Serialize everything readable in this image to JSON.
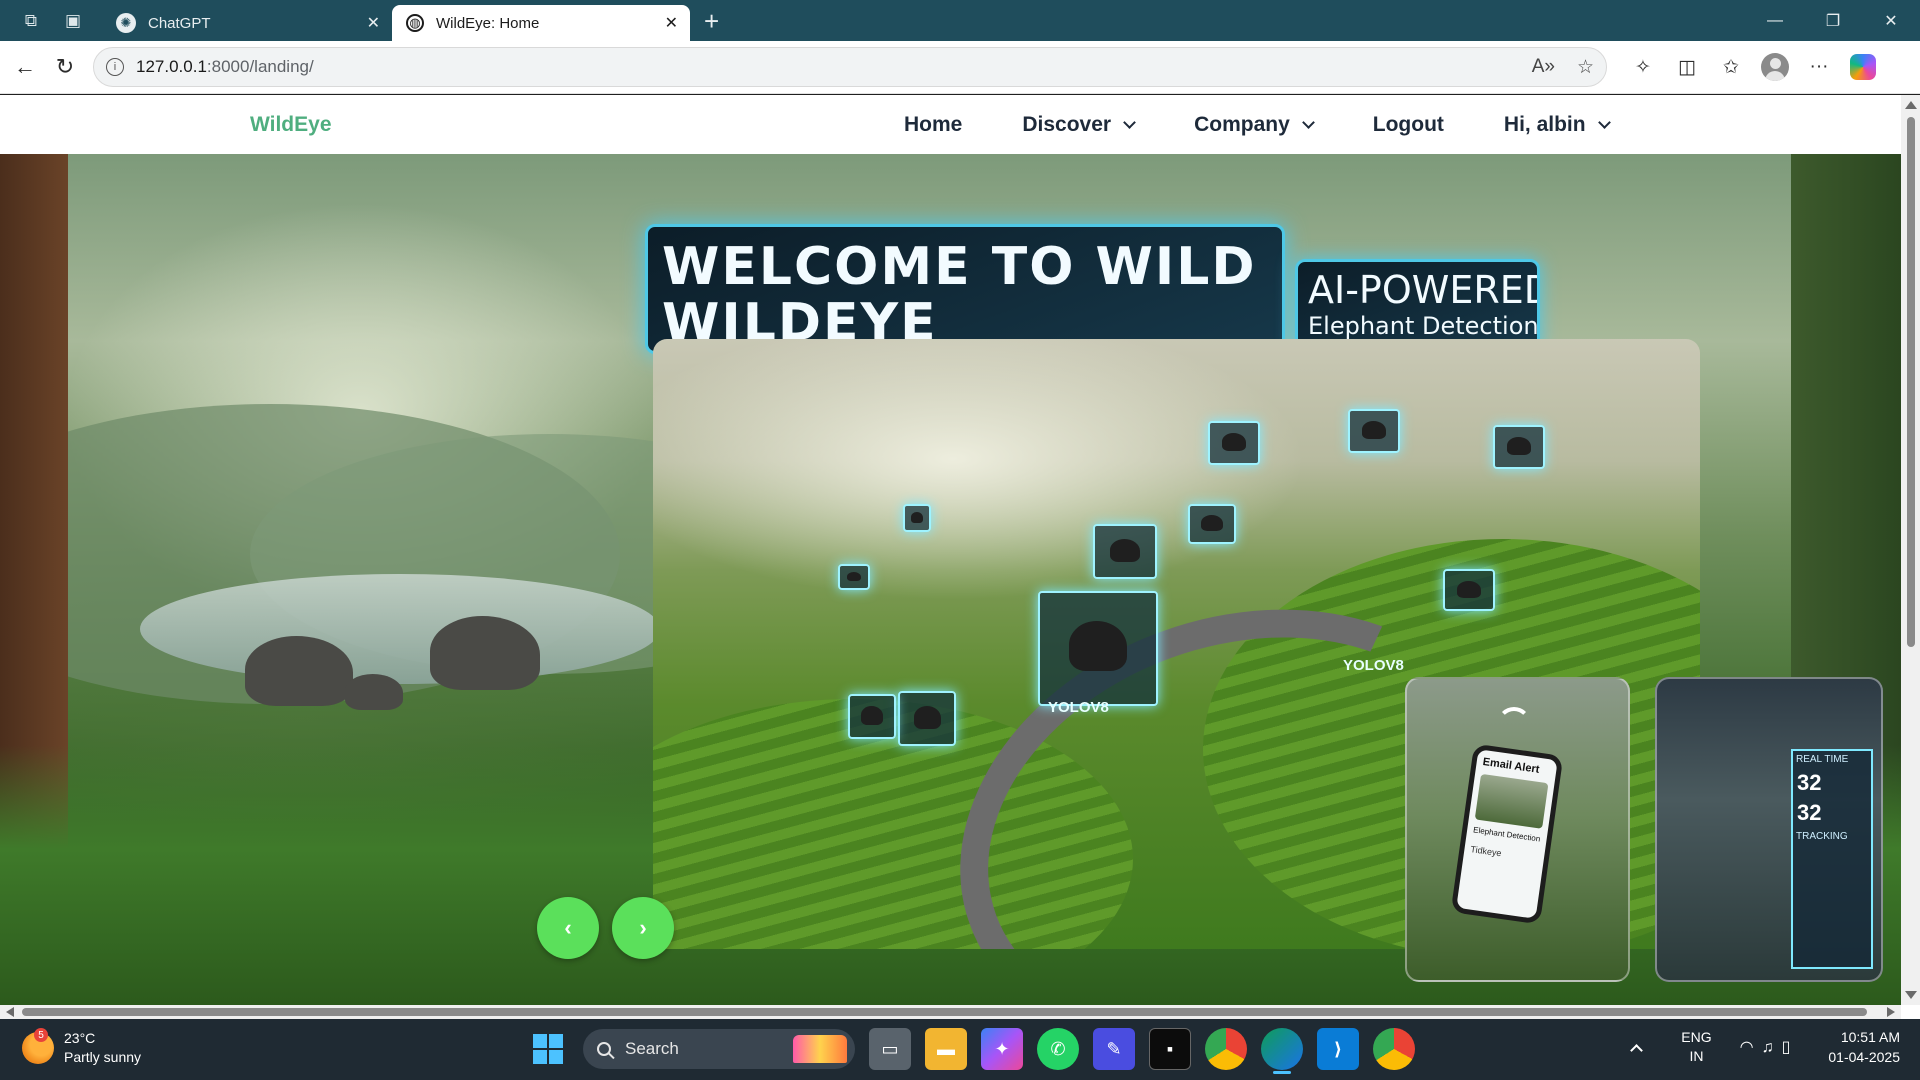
{
  "browser": {
    "tabs": [
      {
        "title": "ChatGPT",
        "icon": "chatgpt-icon",
        "active": false
      },
      {
        "title": "WildEye: Home",
        "icon": "globe-icon",
        "active": true
      }
    ],
    "new_tab_symbol": "+",
    "address": {
      "host": "127.0.0.1",
      "path": ":8000/landing/"
    }
  },
  "site": {
    "brand": "WildEye",
    "nav": {
      "home": "Home",
      "discover": "Discover",
      "company": "Company",
      "logout": "Logout",
      "user": "Hi, albin"
    },
    "accent_color": "#4fae7f"
  },
  "hero": {
    "banner_text": "WELCOME TO WILD\nWILDEYE",
    "banner2_line1": "AI-POWERED",
    "banner2_line2": "Elephant Detection",
    "yolo_label_1": "YOLOV8",
    "yolo_label_2": "YOLOV8",
    "phone_title": "Email Alert",
    "phone_text": "Elephant Detection",
    "phone_text2": "Tidkeye",
    "monitor_label": "REAL TIME",
    "monitor_num_1": "32",
    "monitor_num_2": "32",
    "monitor_label_2": "TRACKING",
    "prev_symbol": "‹",
    "next_symbol": "›",
    "button_color": "#5be05b"
  },
  "taskbar": {
    "weather_temp": "23°C",
    "weather_desc": "Partly sunny",
    "weather_badge": "5",
    "search_label": "Search",
    "lang_top": "ENG",
    "lang_bottom": "IN",
    "time": "10:51 AM",
    "date": "01-04-2025"
  }
}
